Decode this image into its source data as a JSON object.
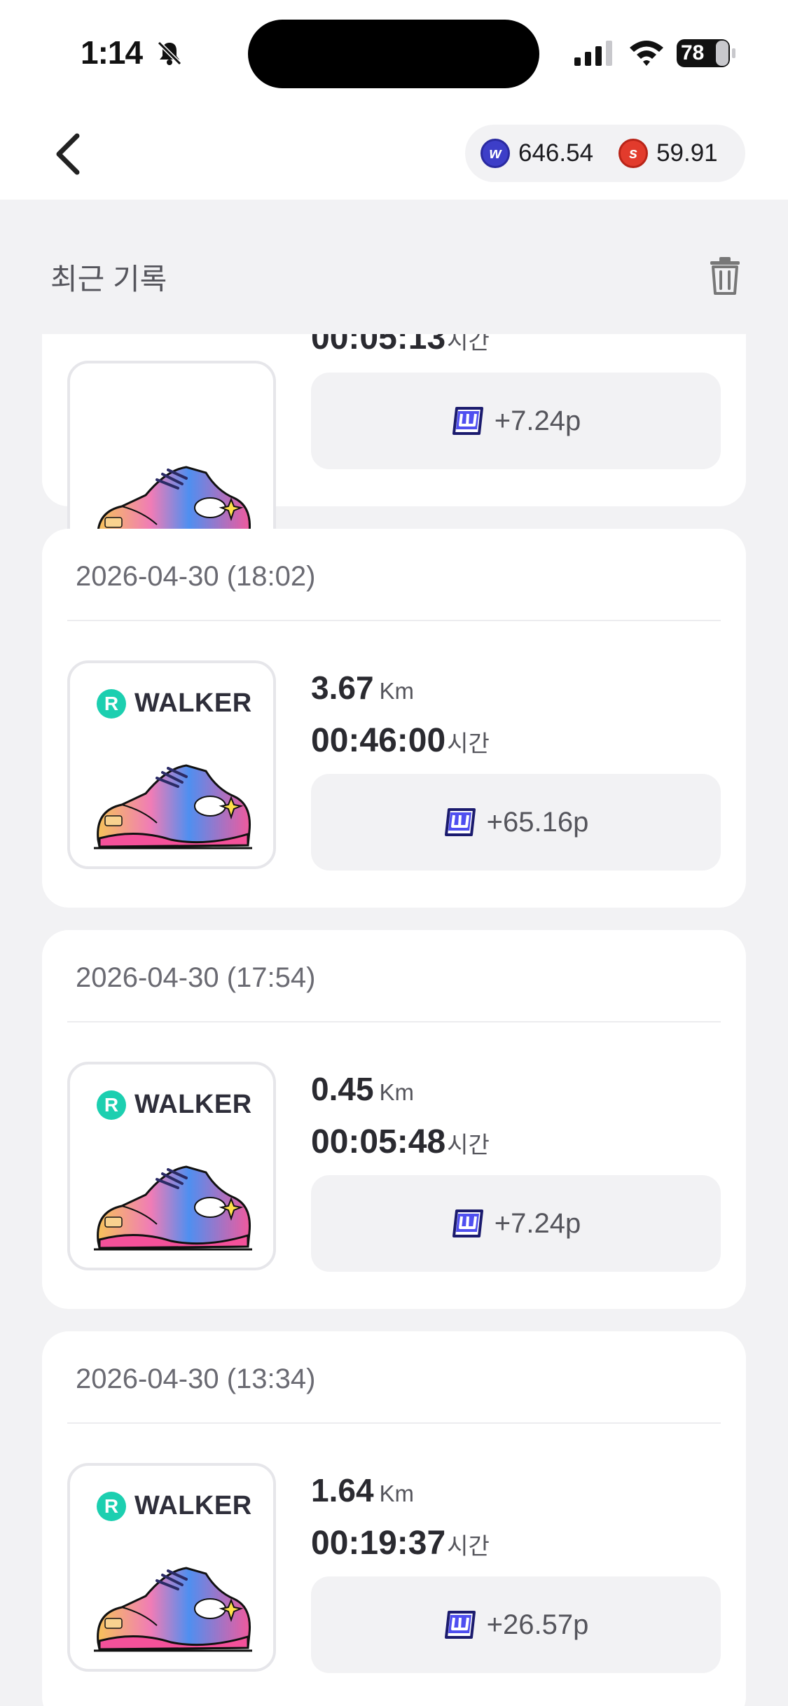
{
  "status_bar": {
    "time": "1:14",
    "battery": "78"
  },
  "header": {
    "w_points": "646.54",
    "s_points": "59.91"
  },
  "section": {
    "title": "최근 기록"
  },
  "brand": "WALKER",
  "units": {
    "distance": "Km",
    "duration": "시간"
  },
  "records": [
    {
      "date": "",
      "distance": "",
      "duration": "00:05:13",
      "reward": "+7.24p"
    },
    {
      "date": "2026-04-30 (18:02)",
      "distance": "3.67",
      "duration": "00:46:00",
      "reward": "+65.16p"
    },
    {
      "date": "2026-04-30 (17:54)",
      "distance": "0.45",
      "duration": "00:05:48",
      "reward": "+7.24p"
    },
    {
      "date": "2026-04-30 (13:34)",
      "distance": "1.64",
      "duration": "00:19:37",
      "reward": "+26.57p"
    }
  ],
  "colors": {
    "accent_mint": "#1ccfb0",
    "coin_blue": "#3d3ec8",
    "coin_red": "#e23b2c"
  }
}
